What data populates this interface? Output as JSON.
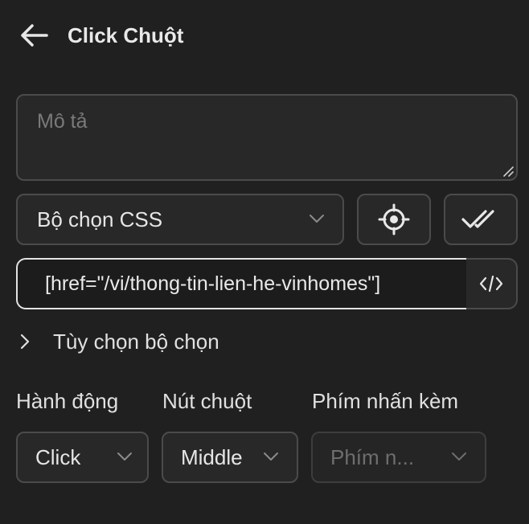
{
  "header": {
    "title": "Click Chuột"
  },
  "description": {
    "placeholder": "Mô tả"
  },
  "selector_type": {
    "selected": "Bộ chọn CSS"
  },
  "selector": {
    "value": "[href=\"/vi/thong-tin-lien-he-vinhomes\"]"
  },
  "selector_options": {
    "label": "Tùy chọn bộ chọn"
  },
  "action": {
    "label": "Hành động",
    "selected": "Click"
  },
  "mouse_button": {
    "label": "Nút chuột",
    "selected": "Middle"
  },
  "modifier_keys": {
    "label": "Phím nhấn kèm",
    "placeholder": "Phím n..."
  },
  "icons": {
    "back": "arrow-left-icon",
    "target": "crosshair-icon",
    "verify": "double-check-icon",
    "code": "code-icon",
    "expand": "chevron-right-icon",
    "dropdown": "chevron-down-icon"
  },
  "colors": {
    "background": "#202020",
    "border": "#4b4b4b",
    "focus_border": "#e3e3e3"
  }
}
